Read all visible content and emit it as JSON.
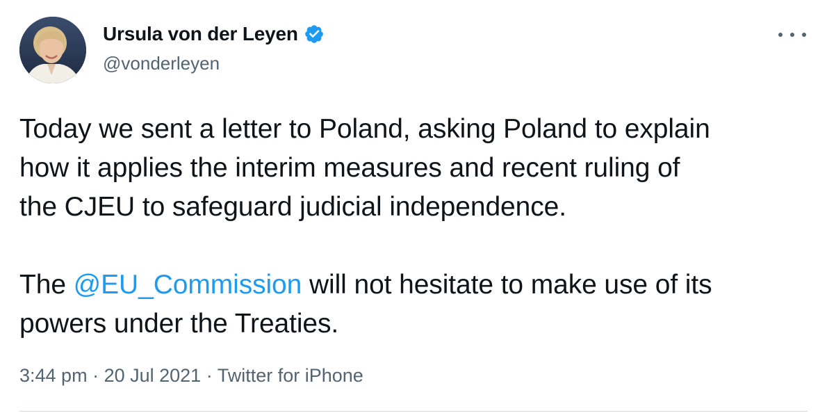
{
  "author": {
    "display_name": "Ursula von der Leyen",
    "handle": "@vonderleyen",
    "verified": true,
    "verified_icon": "verified-badge-icon",
    "avatar_icon": "profile-photo"
  },
  "menu": {
    "icon": "more-horizontal-icon"
  },
  "tweet": {
    "line1": "Today we sent a letter to Poland, asking Poland to explain",
    "line2": "how it applies the interim measures and recent ruling of",
    "line3": "the CJEU to safeguard judicial independence.",
    "para2_prefix": "The ",
    "mention": "@EU_Commission",
    "para2_suffix": " will not hesitate to make use of its",
    "line5": "powers under the Treaties."
  },
  "meta": {
    "time": "3:44 pm",
    "separator": " · ",
    "date": "20 Jul 2021",
    "source": "Twitter for iPhone"
  },
  "colors": {
    "link": "#1d9bf0",
    "text": "#0f1419",
    "secondary": "#536471",
    "divider": "#cfd9de"
  }
}
